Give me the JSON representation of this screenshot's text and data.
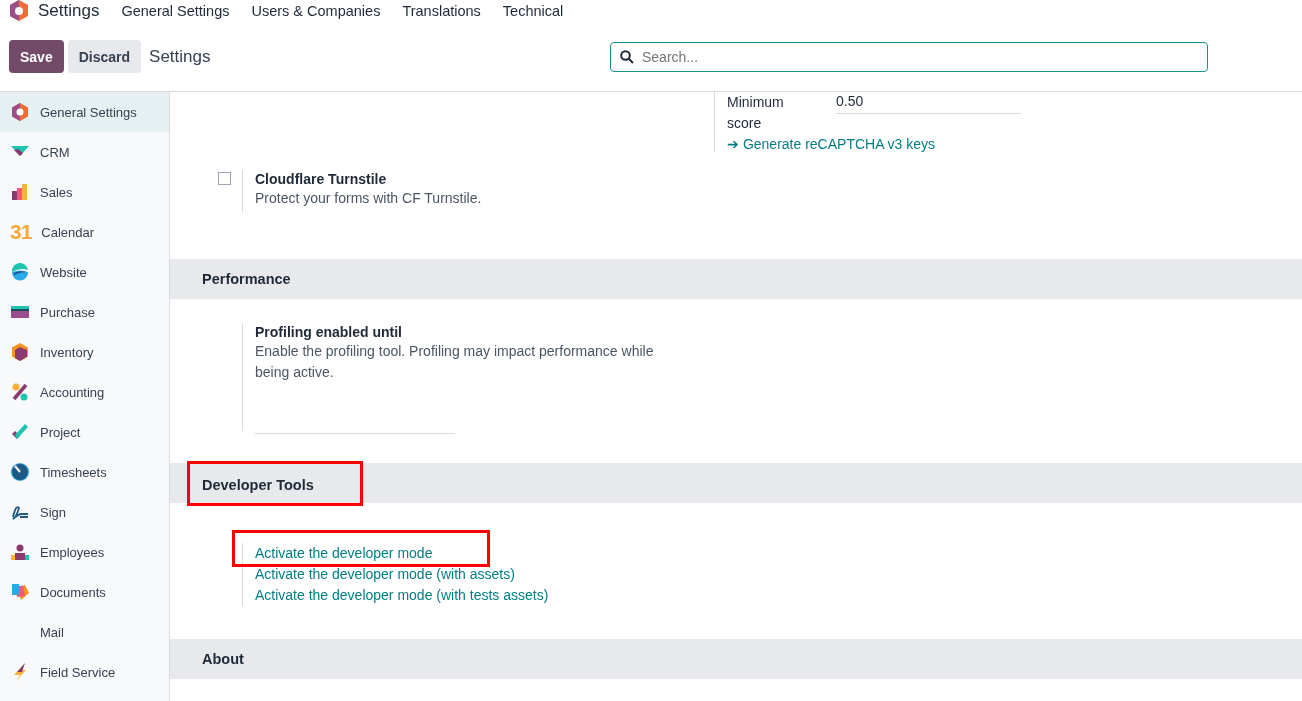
{
  "app": {
    "name": "Settings"
  },
  "menu": [
    {
      "label": "General Settings"
    },
    {
      "label": "Users & Companies"
    },
    {
      "label": "Translations"
    },
    {
      "label": "Technical"
    }
  ],
  "control_panel": {
    "save": "Save",
    "discard": "Discard",
    "breadcrumb": "Settings",
    "search": {
      "placeholder": "Search..."
    }
  },
  "sidebar": {
    "items": [
      {
        "label": "General Settings",
        "selected": true
      },
      {
        "label": "CRM",
        "selected": false
      },
      {
        "label": "Sales",
        "selected": false
      },
      {
        "label": "Calendar",
        "selected": false,
        "icon_text": "31"
      },
      {
        "label": "Website",
        "selected": false
      },
      {
        "label": "Purchase",
        "selected": false
      },
      {
        "label": "Inventory",
        "selected": false
      },
      {
        "label": "Accounting",
        "selected": false
      },
      {
        "label": "Project",
        "selected": false
      },
      {
        "label": "Timesheets",
        "selected": false
      },
      {
        "label": "Sign",
        "selected": false
      },
      {
        "label": "Employees",
        "selected": false
      },
      {
        "label": "Documents",
        "selected": false
      },
      {
        "label": "Mail",
        "selected": false
      },
      {
        "label": "Field Service",
        "selected": false
      }
    ]
  },
  "recaptcha": {
    "label": "Minimum score",
    "value": "0.50",
    "link": "➔ Generate reCAPTCHA v3 keys"
  },
  "cloudflare": {
    "title": "Cloudflare Turnstile",
    "description": "Protect your forms with CF Turnstile.",
    "checked": false
  },
  "sections": [
    {
      "title": "Performance",
      "highlighted": false,
      "setting": {
        "title": "Profiling enabled until",
        "description": "Enable the profiling tool. Profiling may impact performance while being active."
      }
    },
    {
      "title": "Developer Tools",
      "highlighted": true,
      "links": [
        {
          "label": "Activate the developer mode",
          "highlighted": true
        },
        {
          "label": "Activate the developer mode (with assets)",
          "highlighted": false
        },
        {
          "label": "Activate the developer mode (with tests assets)",
          "highlighted": false
        }
      ]
    },
    {
      "title": "About",
      "highlighted": false
    }
  ]
}
